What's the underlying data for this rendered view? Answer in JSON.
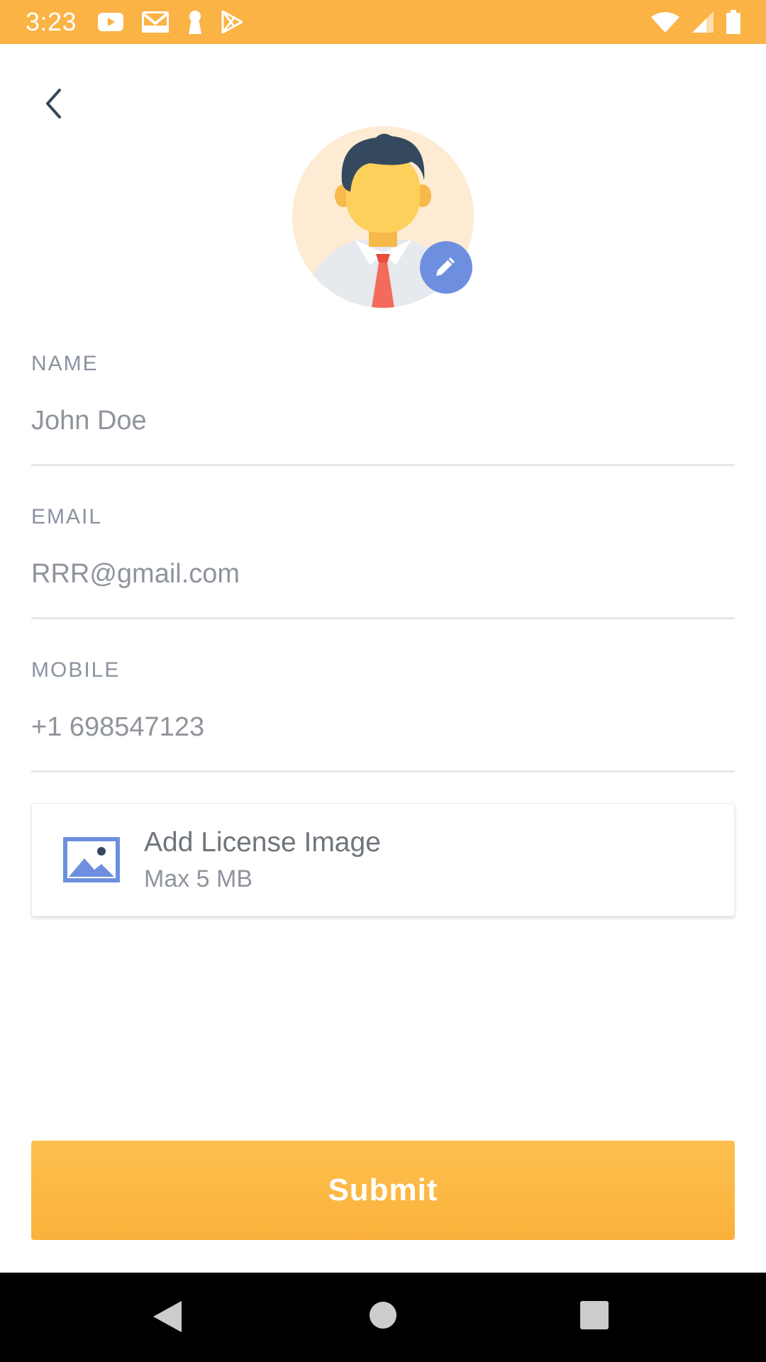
{
  "status_bar": {
    "time": "3:23",
    "icons_left": [
      "youtube-icon",
      "gmail-icon",
      "keyhole-icon",
      "play-store-icon"
    ],
    "icons_right": [
      "wifi-icon",
      "signal-icon",
      "battery-icon"
    ],
    "background": "#FBB345"
  },
  "header": {
    "back_icon": "chevron-left-icon"
  },
  "avatar": {
    "edit_icon": "pencil-icon",
    "edit_color": "#6E8FE0"
  },
  "form": {
    "name": {
      "label": "NAME",
      "value": "John Doe"
    },
    "email": {
      "label": "EMAIL",
      "value": "RRR@gmail.com"
    },
    "mobile": {
      "label": "MOBILE",
      "value": "+1 698547123"
    }
  },
  "license": {
    "title": "Add License Image",
    "subtitle": "Max 5 MB",
    "icon": "image-icon",
    "icon_color": "#6E8FE0"
  },
  "submit": {
    "label": "Submit",
    "color": "#FBB13C"
  },
  "nav_bar": {
    "icons": [
      "back-triangle-icon",
      "home-circle-icon",
      "recents-square-icon"
    ]
  }
}
